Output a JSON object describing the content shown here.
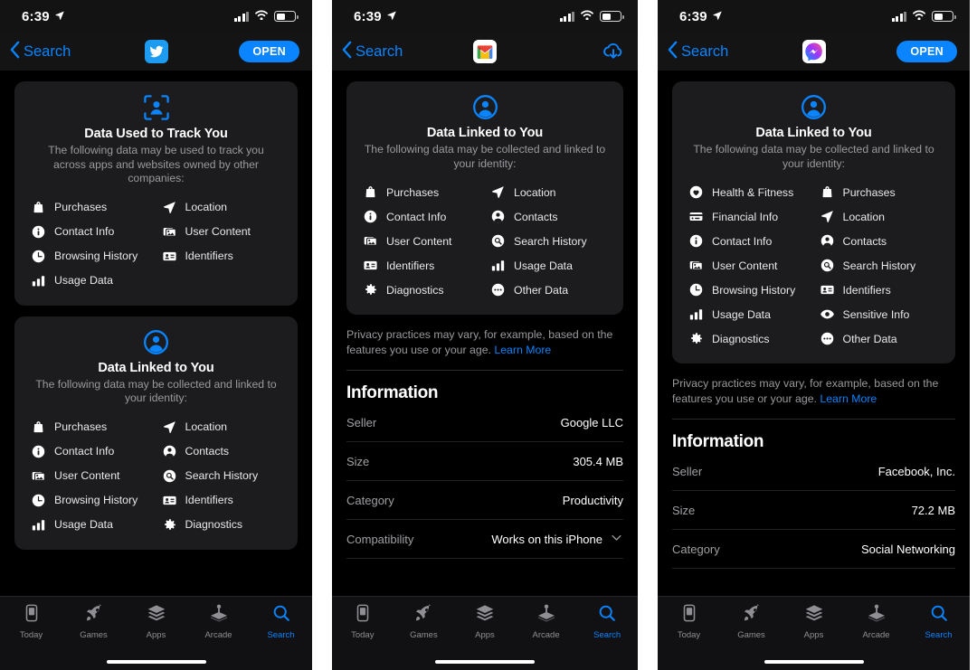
{
  "meta": {
    "accent": "#0a84ff",
    "card_bg": "#1c1c1e",
    "page_bg": "#000000"
  },
  "status_bar": {
    "time": "6:39",
    "location_arrow": "location-arrow",
    "signal": "signal-bars",
    "wifi": "wifi",
    "battery": "battery"
  },
  "tabs": [
    {
      "label": "Today",
      "icon": "today-icon",
      "active": false
    },
    {
      "label": "Games",
      "icon": "rocket-icon",
      "active": false
    },
    {
      "label": "Apps",
      "icon": "layers-icon",
      "active": false
    },
    {
      "label": "Arcade",
      "icon": "joystick-icon",
      "active": false
    },
    {
      "label": "Search",
      "icon": "search-icon",
      "active": true
    }
  ],
  "panels": [
    {
      "id": "twitter",
      "nav": {
        "back_label": "Search",
        "app_icon": "twitter-bird-icon",
        "action_label": "OPEN",
        "action_type": "open"
      },
      "cards": [
        {
          "icon": "track-person-icon",
          "title": "Data Used to Track You",
          "subtitle": "The following data may be used to track you across apps and websites owned by other companies:",
          "items": [
            {
              "label": "Purchases",
              "icon": "bag-icon"
            },
            {
              "label": "Location",
              "icon": "location-arrow-icon"
            },
            {
              "label": "Contact Info",
              "icon": "info-circle-icon"
            },
            {
              "label": "User Content",
              "icon": "photo-stack-icon"
            },
            {
              "label": "Browsing History",
              "icon": "clock-icon"
            },
            {
              "label": "Identifiers",
              "icon": "id-card-icon"
            },
            {
              "label": "Usage Data",
              "icon": "bar-chart-icon"
            }
          ]
        },
        {
          "icon": "person-circle-icon",
          "title": "Data Linked to You",
          "subtitle": "The following data may be collected and linked to your identity:",
          "items": [
            {
              "label": "Purchases",
              "icon": "bag-icon"
            },
            {
              "label": "Location",
              "icon": "location-arrow-icon"
            },
            {
              "label": "Contact Info",
              "icon": "info-circle-icon"
            },
            {
              "label": "Contacts",
              "icon": "person-circle-icon"
            },
            {
              "label": "User Content",
              "icon": "photo-stack-icon"
            },
            {
              "label": "Search History",
              "icon": "magnifier-circle-icon"
            },
            {
              "label": "Browsing History",
              "icon": "clock-icon"
            },
            {
              "label": "Identifiers",
              "icon": "id-card-icon"
            },
            {
              "label": "Usage Data",
              "icon": "bar-chart-icon"
            },
            {
              "label": "Diagnostics",
              "icon": "gear-icon"
            }
          ]
        }
      ],
      "note": null,
      "information": null
    },
    {
      "id": "gmail",
      "nav": {
        "back_label": "Search",
        "app_icon": "gmail-m-icon",
        "action_label": "",
        "action_type": "download"
      },
      "cards": [
        {
          "icon": "person-circle-icon",
          "title": "Data Linked to You",
          "subtitle": "The following data may be collected and linked to your identity:",
          "items": [
            {
              "label": "Purchases",
              "icon": "bag-icon"
            },
            {
              "label": "Location",
              "icon": "location-arrow-icon"
            },
            {
              "label": "Contact Info",
              "icon": "info-circle-icon"
            },
            {
              "label": "Contacts",
              "icon": "person-circle-icon"
            },
            {
              "label": "User Content",
              "icon": "photo-stack-icon"
            },
            {
              "label": "Search History",
              "icon": "magnifier-circle-icon"
            },
            {
              "label": "Identifiers",
              "icon": "id-card-icon"
            },
            {
              "label": "Usage Data",
              "icon": "bar-chart-icon"
            },
            {
              "label": "Diagnostics",
              "icon": "gear-icon"
            },
            {
              "label": "Other Data",
              "icon": "ellipsis-circle-icon"
            }
          ]
        }
      ],
      "note": {
        "text": "Privacy practices may vary, for example, based on the features you use or your age. ",
        "link": "Learn More"
      },
      "information": {
        "title": "Information",
        "rows": [
          {
            "key": "Seller",
            "value": "Google LLC"
          },
          {
            "key": "Size",
            "value": "305.4 MB"
          },
          {
            "key": "Category",
            "value": "Productivity"
          },
          {
            "key": "Compatibility",
            "value": "Works on this iPhone",
            "chevron": "chevron-down-icon"
          }
        ]
      }
    },
    {
      "id": "messenger",
      "nav": {
        "back_label": "Search",
        "app_icon": "messenger-bolt-icon",
        "action_label": "OPEN",
        "action_type": "open"
      },
      "cards": [
        {
          "icon": "person-circle-icon",
          "title": "Data Linked to You",
          "subtitle": "The following data may be collected and linked to your identity:",
          "items": [
            {
              "label": "Health & Fitness",
              "icon": "heart-circle-icon"
            },
            {
              "label": "Purchases",
              "icon": "bag-icon"
            },
            {
              "label": "Financial Info",
              "icon": "credit-card-icon"
            },
            {
              "label": "Location",
              "icon": "location-arrow-icon"
            },
            {
              "label": "Contact Info",
              "icon": "info-circle-icon"
            },
            {
              "label": "Contacts",
              "icon": "person-circle-icon"
            },
            {
              "label": "User Content",
              "icon": "photo-stack-icon"
            },
            {
              "label": "Search History",
              "icon": "magnifier-circle-icon"
            },
            {
              "label": "Browsing History",
              "icon": "clock-icon"
            },
            {
              "label": "Identifiers",
              "icon": "id-card-icon"
            },
            {
              "label": "Usage Data",
              "icon": "bar-chart-icon"
            },
            {
              "label": "Sensitive Info",
              "icon": "eye-icon"
            },
            {
              "label": "Diagnostics",
              "icon": "gear-icon"
            },
            {
              "label": "Other Data",
              "icon": "ellipsis-circle-icon"
            }
          ]
        }
      ],
      "note": {
        "text": "Privacy practices may vary, for example, based on the features you use or your age. ",
        "link": "Learn More"
      },
      "information": {
        "title": "Information",
        "rows": [
          {
            "key": "Seller",
            "value": "Facebook, Inc."
          },
          {
            "key": "Size",
            "value": "72.2 MB"
          },
          {
            "key": "Category",
            "value": "Social Networking"
          }
        ]
      }
    }
  ]
}
